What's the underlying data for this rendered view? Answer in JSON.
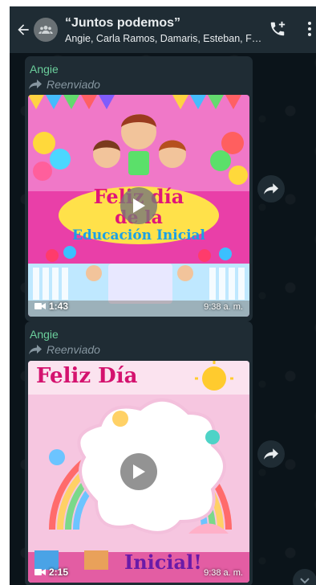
{
  "header": {
    "title": "“Juntos podemos”",
    "participants": "Angie, Carla Ramos, Damaris, Esteban, Fa..."
  },
  "messages": [
    {
      "sender": "Angie",
      "forwarded_label": "Reenviado",
      "video": {
        "duration": "1:43",
        "time": "9:38 a. m.",
        "title_line1": "Feliz día",
        "title_line2": "de la",
        "title_line3": "Educación Inicial"
      }
    },
    {
      "sender": "Angie",
      "forwarded_label": "Reenviado",
      "video": {
        "duration": "2:15",
        "time": "9:38 a. m.",
        "top_text": "Feliz Día",
        "bottom_text": "Inicial!"
      }
    }
  ],
  "icons": {
    "back": "arrow-left-icon",
    "group": "group-avatar-icon",
    "add_call": "add-call-icon",
    "menu": "more-vert-icon",
    "forward": "forward-icon",
    "share": "share-icon",
    "video": "video-camera-icon",
    "scroll": "chevron-down-icon"
  }
}
